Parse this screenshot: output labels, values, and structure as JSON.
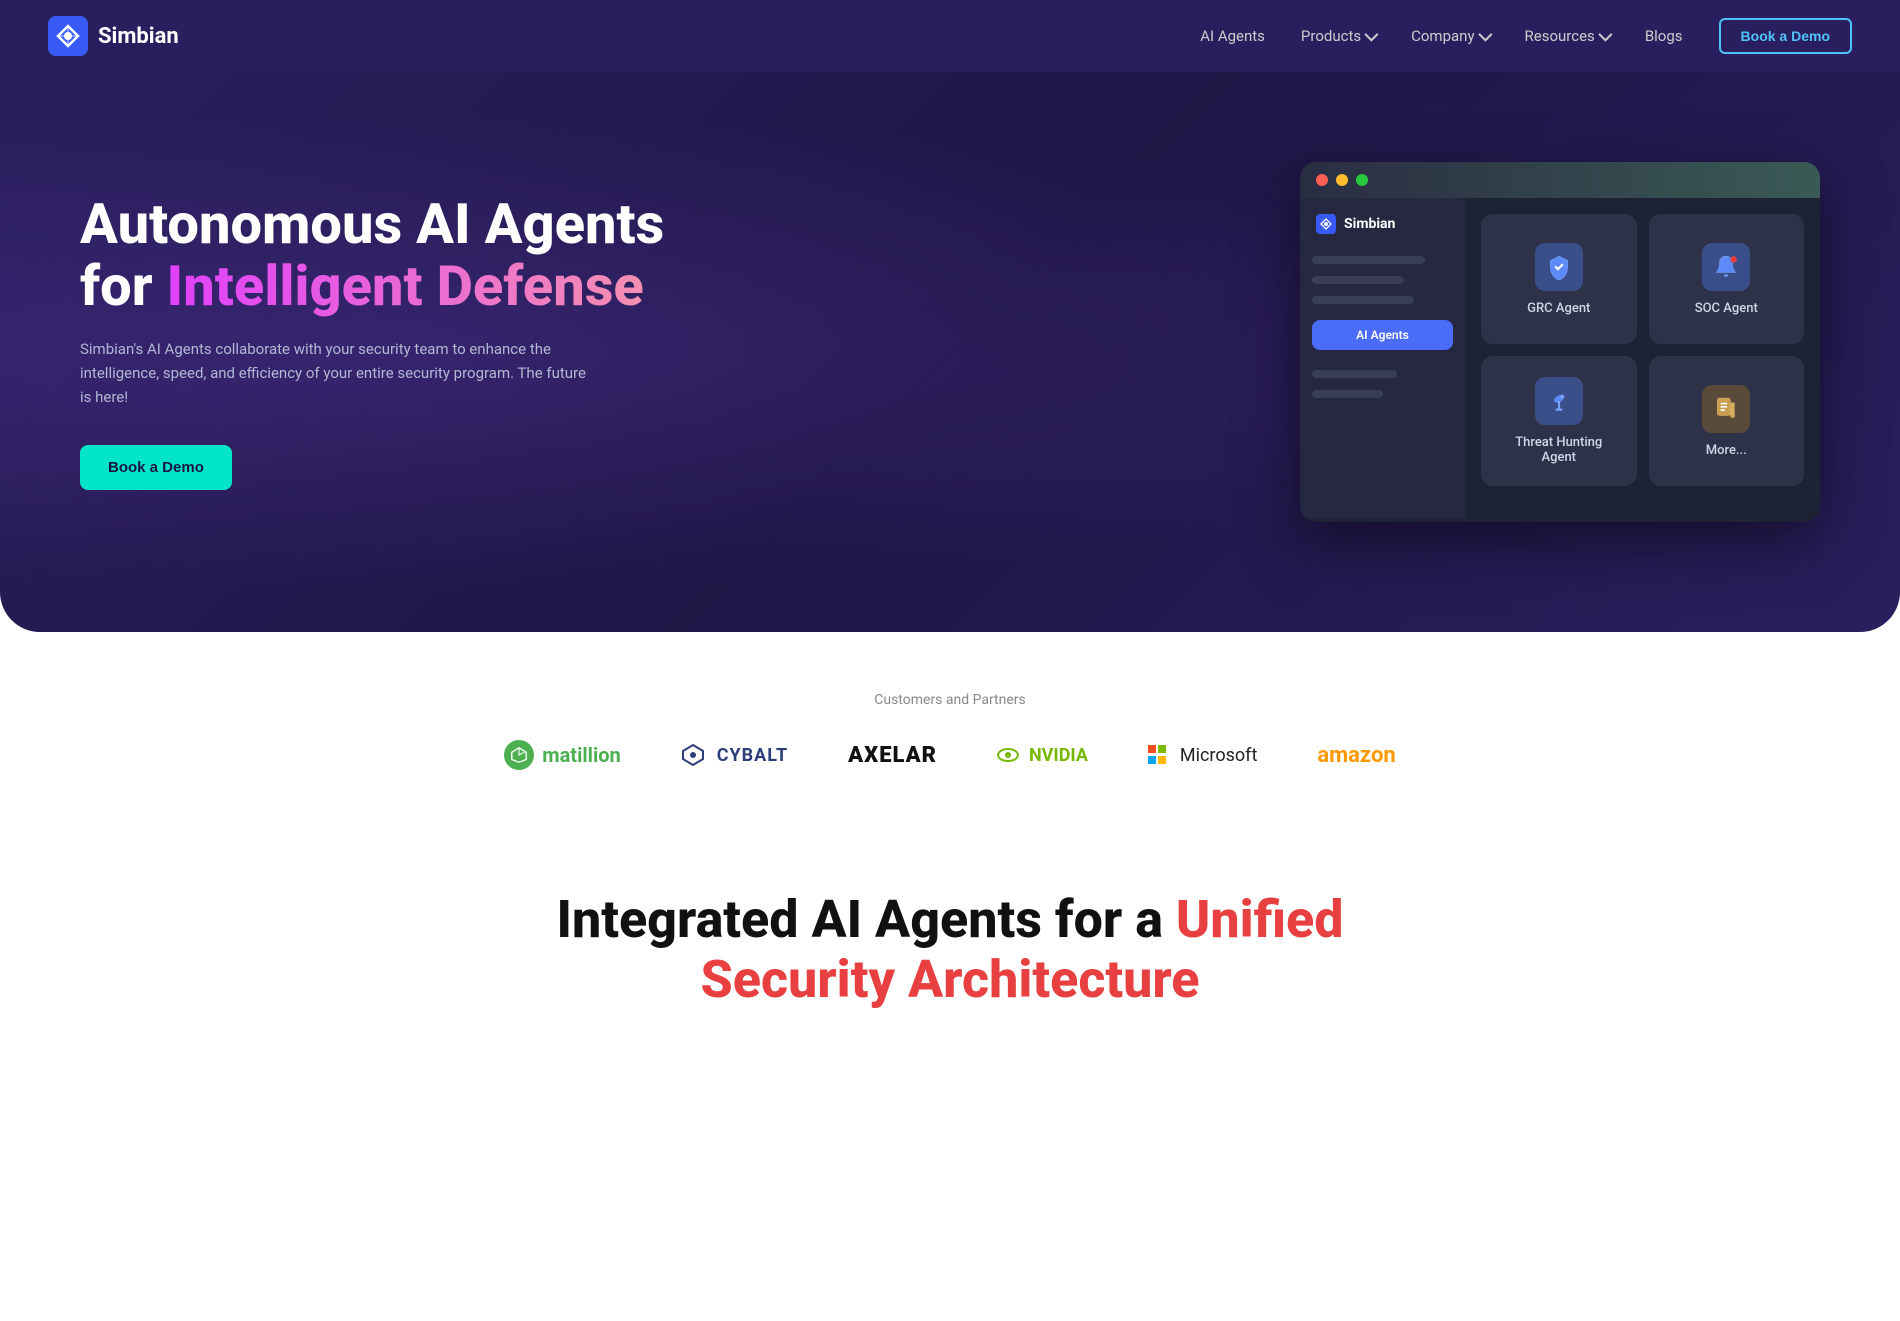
{
  "navbar": {
    "logo_text": "Simbian",
    "links": [
      {
        "label": "AI Agents",
        "has_dropdown": false
      },
      {
        "label": "Products",
        "has_dropdown": true
      },
      {
        "label": "Company",
        "has_dropdown": true
      },
      {
        "label": "Resources",
        "has_dropdown": true
      },
      {
        "label": "Blogs",
        "has_dropdown": false
      }
    ],
    "cta_label": "Book a Demo"
  },
  "hero": {
    "title_line1": "Autonomous AI Agents",
    "title_line2_plain": "for ",
    "title_line2_accent": "Intelligent Defense",
    "subtitle": "Simbian's AI Agents collaborate with your security team to enhance the intelligence, speed, and efficiency of your entire security program. The future is here!",
    "cta_label": "Book a Demo"
  },
  "app_window": {
    "sidebar_logo": "Simbian",
    "active_tab": "AI Agents",
    "agents": [
      {
        "label": "GRC Agent",
        "icon": "🛡️",
        "icon_class": "icon-grc"
      },
      {
        "label": "SOC Agent",
        "icon": "🔔",
        "icon_class": "icon-soc"
      },
      {
        "label": "Threat Hunting Agent",
        "icon": "🔭",
        "icon_class": "icon-threat"
      },
      {
        "label": "More...",
        "icon": "📋",
        "icon_class": "icon-more"
      }
    ]
  },
  "partners": {
    "title": "Customers and Partners",
    "logos": [
      {
        "name": "matillion",
        "text": "matillion"
      },
      {
        "name": "cybalt",
        "text": "CYBALT"
      },
      {
        "name": "axelar",
        "text": "AXELAR"
      },
      {
        "name": "nvidia",
        "text": "NVIDIA"
      },
      {
        "name": "microsoft",
        "text": "Microsoft"
      },
      {
        "name": "amazon",
        "text": "amazon"
      }
    ]
  },
  "bottom": {
    "title_plain": "Integrated AI Agents for a ",
    "title_accent": "Unified",
    "title_line2": "Security Architecture"
  }
}
